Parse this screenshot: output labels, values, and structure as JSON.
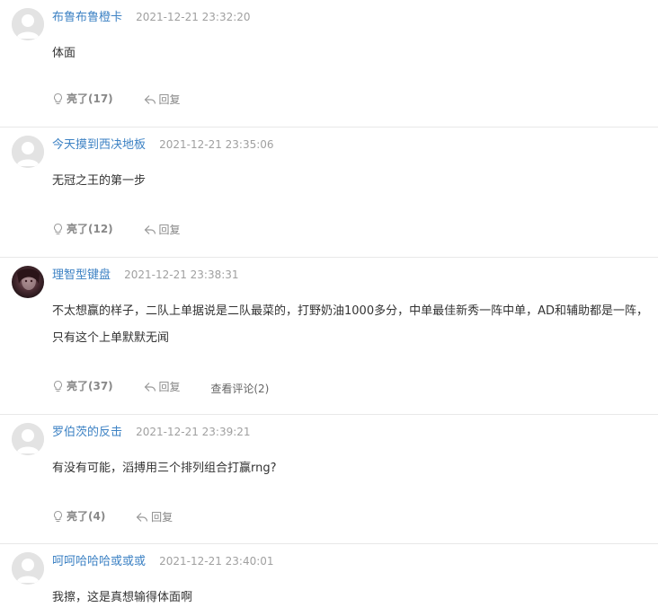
{
  "comments": [
    {
      "username": "布鲁布鲁橙卡",
      "timestamp": "2021-12-21 23:32:20",
      "content": "体面",
      "like_label": "亮了(17)",
      "reply_label": "回复"
    },
    {
      "username": "今天摸到西决地板",
      "timestamp": "2021-12-21 23:35:06",
      "content": "无冠之王的第一步",
      "like_label": "亮了(12)",
      "reply_label": "回复"
    },
    {
      "username": "理智型键盘",
      "timestamp": "2021-12-21 23:38:31",
      "content": "不太想赢的样子，二队上单据说是二队最菜的，打野奶油1000多分，中单最佳新秀一阵中单，AD和辅助都是一阵，只有这个上单默默无闻",
      "like_label": "亮了(37)",
      "reply_label": "回复",
      "view_replies_label": "查看评论(2)"
    },
    {
      "username": "罗伯茨的反击",
      "timestamp": "2021-12-21 23:39:21",
      "content": "有没有可能，滔搏用三个排列组合打赢rng?",
      "like_label": "亮了(4)",
      "reply_label": "回复"
    },
    {
      "username": "呵呵哈哈哈或或或",
      "timestamp": "2021-12-21 23:40:01",
      "content": "我擦，这是真想输得体面啊"
    }
  ],
  "colors": {
    "username": "#3d82c4",
    "timestamp": "#a0a0a0",
    "divider": "#e8e8e8"
  },
  "icons": {
    "like": "lightbulb-icon",
    "reply": "reply-arrow-icon",
    "avatar_default": "default-avatar-icon"
  }
}
